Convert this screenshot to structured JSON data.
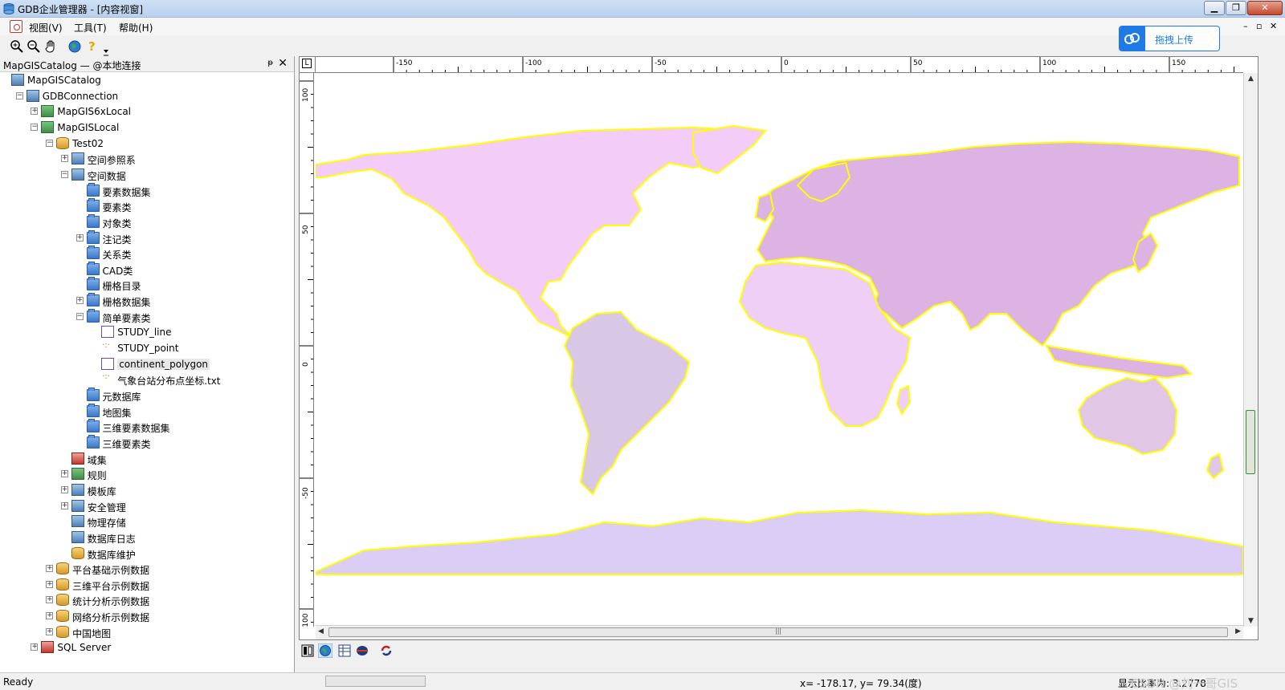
{
  "window": {
    "title": "GDB企业管理器 - [内容视窗]",
    "minimize": "▁",
    "restore": "❐",
    "close": "✕"
  },
  "menubar": {
    "items": [
      "视图(V)",
      "工具(T)",
      "帮助(H)"
    ],
    "mdi_controls": [
      "–",
      "▫",
      "✕"
    ]
  },
  "upload": {
    "label": "拖拽上传"
  },
  "panel": {
    "title": "MapGISCatalog — @本地连接",
    "pin": "ᵽ",
    "close": "✕"
  },
  "tree": [
    {
      "label": "MapGISCatalog",
      "level": 0,
      "icon": "catalog-icon",
      "expander": ""
    },
    {
      "label": "GDBConnection",
      "level": 1,
      "icon": "connection-icon",
      "expander": "−"
    },
    {
      "label": "MapGIS6xLocal",
      "level": 2,
      "icon": "server-icon",
      "expander": "+"
    },
    {
      "label": "MapGISLocal",
      "level": 2,
      "icon": "server-icon",
      "expander": "−"
    },
    {
      "label": "Test02",
      "level": 3,
      "icon": "database-icon",
      "expander": "−"
    },
    {
      "label": "空间参照系",
      "level": 4,
      "icon": "globe-icon",
      "expander": "+"
    },
    {
      "label": "空间数据",
      "level": 4,
      "icon": "spatial-data-icon",
      "expander": "−"
    },
    {
      "label": "要素数据集",
      "level": 5,
      "icon": "folder-icon",
      "expander": ""
    },
    {
      "label": "要素类",
      "level": 5,
      "icon": "folder-icon",
      "expander": ""
    },
    {
      "label": "对象类",
      "level": 5,
      "icon": "folder-icon",
      "expander": ""
    },
    {
      "label": "注记类",
      "level": 5,
      "icon": "folder-icon",
      "expander": "+"
    },
    {
      "label": "关系类",
      "level": 5,
      "icon": "folder-icon",
      "expander": ""
    },
    {
      "label": "CAD类",
      "level": 5,
      "icon": "folder-icon",
      "expander": ""
    },
    {
      "label": "栅格目录",
      "level": 5,
      "icon": "folder-icon",
      "expander": ""
    },
    {
      "label": "栅格数据集",
      "level": 5,
      "icon": "folder-icon",
      "expander": "+"
    },
    {
      "label": "简单要素类",
      "level": 5,
      "icon": "folder-icon",
      "expander": "−"
    },
    {
      "label": "STUDY_line",
      "level": 6,
      "icon": "line-layer-icon",
      "expander": ""
    },
    {
      "label": "STUDY_point",
      "level": 6,
      "icon": "point-layer-icon",
      "expander": ""
    },
    {
      "label": "continent_polygon",
      "level": 6,
      "icon": "polygon-layer-icon",
      "expander": "",
      "selected": true
    },
    {
      "label": "气象台站分布点坐标.txt",
      "level": 6,
      "icon": "point-layer-icon",
      "expander": ""
    },
    {
      "label": "元数据库",
      "level": 5,
      "icon": "folder-icon",
      "expander": ""
    },
    {
      "label": "地图集",
      "level": 5,
      "icon": "folder-icon",
      "expander": ""
    },
    {
      "label": "三维要素数据集",
      "level": 5,
      "icon": "folder-icon",
      "expander": ""
    },
    {
      "label": "三维要素类",
      "level": 5,
      "icon": "folder-icon",
      "expander": ""
    },
    {
      "label": "域集",
      "level": 4,
      "icon": "domain-icon",
      "expander": ""
    },
    {
      "label": "规则",
      "level": 4,
      "icon": "rule-icon",
      "expander": "+"
    },
    {
      "label": "模板库",
      "level": 4,
      "icon": "template-icon",
      "expander": "+"
    },
    {
      "label": "安全管理",
      "level": 4,
      "icon": "security-icon",
      "expander": "+"
    },
    {
      "label": "物理存储",
      "level": 4,
      "icon": "storage-icon",
      "expander": ""
    },
    {
      "label": "数据库日志",
      "level": 4,
      "icon": "log-icon",
      "expander": ""
    },
    {
      "label": "数据库维护",
      "level": 4,
      "icon": "maintenance-icon",
      "expander": ""
    },
    {
      "label": "平台基础示例数据",
      "level": 3,
      "icon": "database-icon",
      "expander": "+"
    },
    {
      "label": "三维平台示例数据",
      "level": 3,
      "icon": "database-icon",
      "expander": "+"
    },
    {
      "label": "统计分析示例数据",
      "level": 3,
      "icon": "database-icon",
      "expander": "+"
    },
    {
      "label": "网络分析示例数据",
      "level": 3,
      "icon": "database-icon",
      "expander": "+"
    },
    {
      "label": "中国地图",
      "level": 3,
      "icon": "database-icon",
      "expander": "+"
    },
    {
      "label": "SQL Server",
      "level": 2,
      "icon": "sqlserver-icon",
      "expander": "+"
    }
  ],
  "map": {
    "ruler_corner": "L",
    "hruler_ticks": [
      "-150",
      "-100",
      "-50",
      "0",
      "50",
      "100",
      "150"
    ],
    "vruler_ticks": [
      "100",
      "50",
      "0",
      "-50",
      "-100"
    ],
    "fill_colors": {
      "north_america": "#f3ccf7",
      "south_america": "#d9c7e6",
      "europe_asia": "#ddb3e4",
      "africa": "#efcff5",
      "australia": "#e2c6e6",
      "antarctica": "#dccdf6",
      "outline": "#ffff00"
    },
    "scroll_grip": "|||"
  },
  "status": {
    "ready": "Ready",
    "coords": "x= -178.17, y= 79.34(度)",
    "scale": "显示比率为: 3.2778",
    "watermark": "CSDN @刘一哥GIS"
  }
}
